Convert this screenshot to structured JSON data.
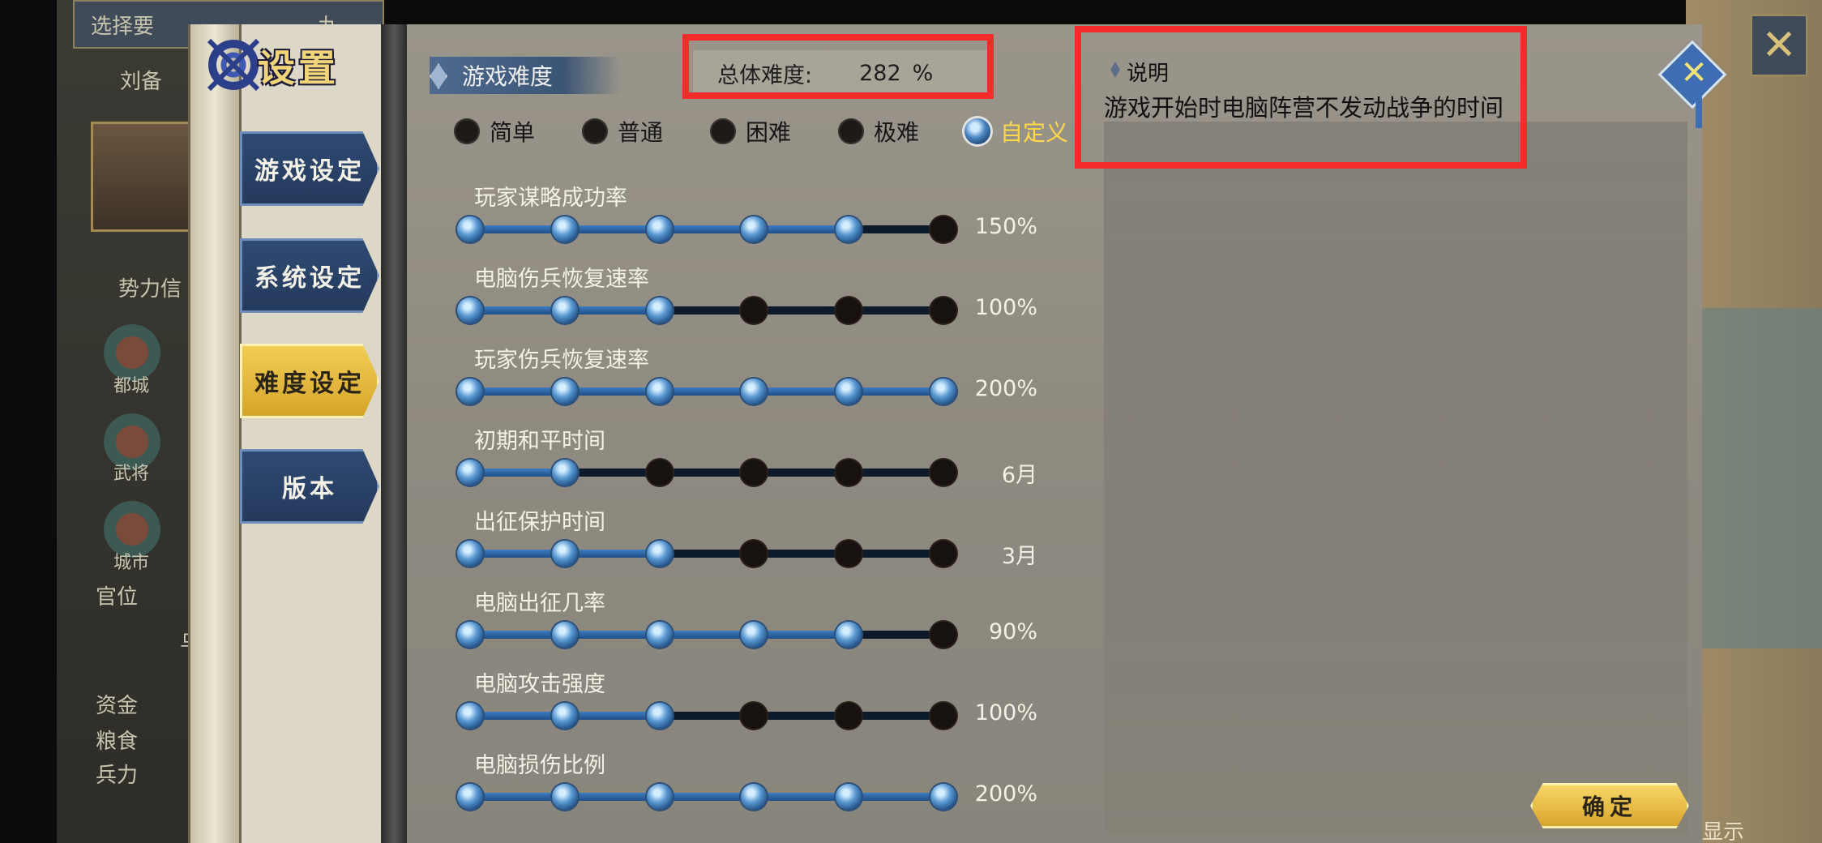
{
  "background": {
    "top_bar": "选择要",
    "top_bar_end": "九",
    "player": "刘备",
    "section": "势力信",
    "icons": [
      "都城",
      "武将",
      "城市"
    ],
    "label_official": "官位",
    "stats": [
      "资金",
      "粮食",
      "兵力"
    ],
    "bottom_right": "显示",
    "fragment_mid": "乌"
  },
  "window": {
    "title": "设置"
  },
  "nav": {
    "items": [
      {
        "label": "游戏设定",
        "active": false
      },
      {
        "label": "系统设定",
        "active": false
      },
      {
        "label": "难度设定",
        "active": true
      },
      {
        "label": "版本",
        "active": false
      }
    ]
  },
  "difficulty": {
    "section_title": "游戏难度",
    "total_label": "总体难度:",
    "total_value": "282",
    "total_unit": "%",
    "options": [
      "简单",
      "普通",
      "困难",
      "极难",
      "自定义"
    ],
    "selected_option": "自定义"
  },
  "sliders": [
    {
      "label": "玩家谋略成功率",
      "value": "150%",
      "level": 5,
      "steps": 6
    },
    {
      "label": "电脑伤兵恢复速率",
      "value": "100%",
      "level": 3,
      "steps": 6
    },
    {
      "label": "玩家伤兵恢复速率",
      "value": "200%",
      "level": 6,
      "steps": 6
    },
    {
      "label": "初期和平时间",
      "value": "6月",
      "level": 2,
      "steps": 6
    },
    {
      "label": "出征保护时间",
      "value": "3月",
      "level": 3,
      "steps": 6
    },
    {
      "label": "电脑出征几率",
      "value": "90%",
      "level": 5,
      "steps": 6
    },
    {
      "label": "电脑攻击强度",
      "value": "100%",
      "level": 3,
      "steps": 6
    },
    {
      "label": "电脑损伤比例",
      "value": "200%",
      "level": 6,
      "steps": 6
    }
  ],
  "description": {
    "title": "说明",
    "text": "游戏开始时电脑阵营不发动战争的时间"
  },
  "buttons": {
    "confirm": "确定"
  },
  "colors": {
    "highlight_box": "#f42b2b",
    "selected_option": "#ffd84a",
    "nav_active": "#f3cd55",
    "nav_inactive": "#2f4a73"
  }
}
